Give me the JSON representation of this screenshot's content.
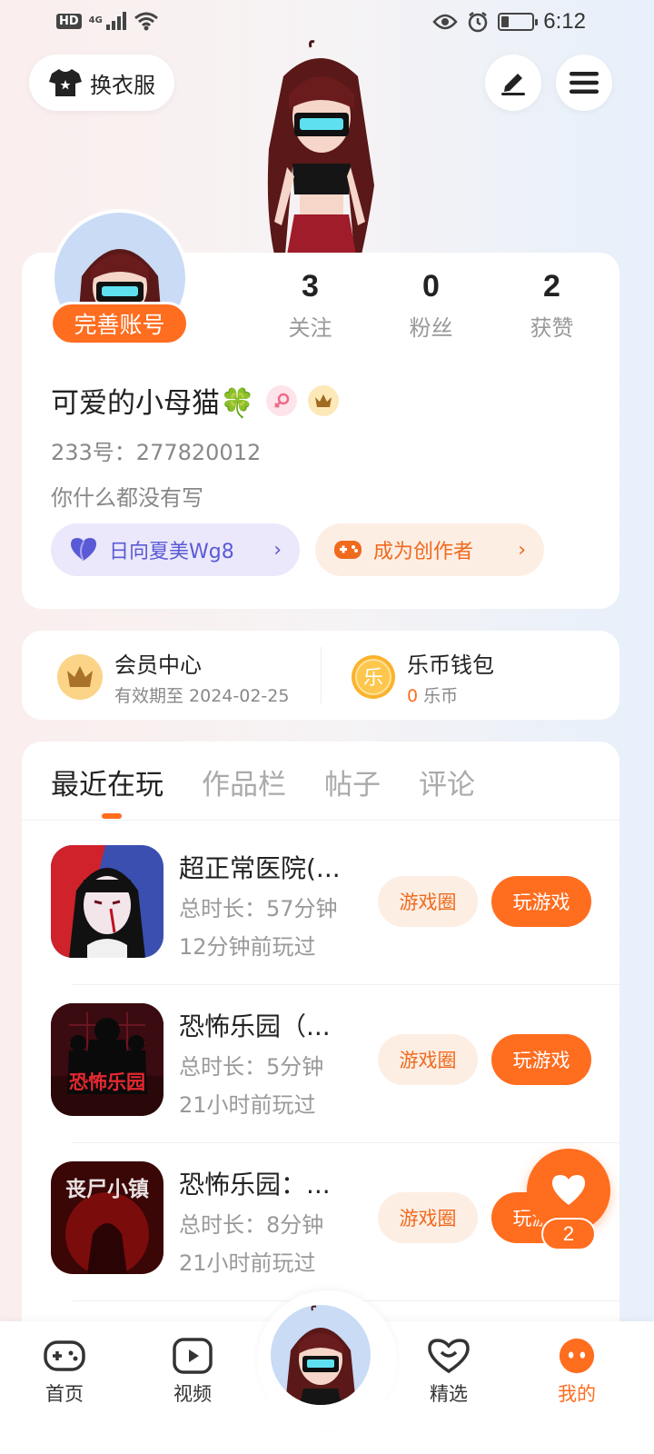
{
  "status_bar": {
    "network_badge": "HD",
    "signal_type": "4G",
    "battery_percent": 25,
    "time": "6:12"
  },
  "top_bar": {
    "outfit_label": "换衣服"
  },
  "profile": {
    "complete_account_label": "完善账号",
    "stats": [
      {
        "value": "3",
        "label": "关注"
      },
      {
        "value": "0",
        "label": "粉丝"
      },
      {
        "value": "2",
        "label": "获赞"
      }
    ],
    "nickname": "可爱的小母猫🍀",
    "uid": "233号：277820012",
    "bio": "你什么都没有写",
    "pill_left": "日向夏美Wg8",
    "pill_right": "成为创作者"
  },
  "vip": {
    "member_title": "会员中心",
    "member_sub": "有效期至 2024-02-25",
    "wallet_icon_char": "乐",
    "wallet_title": "乐币钱包",
    "wallet_amount": "0",
    "wallet_unit": "乐币"
  },
  "tabs": [
    "最近在玩",
    "作品栏",
    "帖子",
    "评论"
  ],
  "games": [
    {
      "title": "超正常医院(...",
      "duration": "总时长：57分钟",
      "last_played": "12分钟前玩过",
      "btn_circle": "游戏圈",
      "btn_play": "玩游戏"
    },
    {
      "title": "恐怖乐园（...",
      "duration": "总时长：5分钟",
      "last_played": "21小时前玩过",
      "btn_circle": "游戏圈",
      "btn_play": "玩游戏",
      "thumb_text": "恐怖乐园"
    },
    {
      "title": "恐怖乐园：...",
      "duration": "总时长：8分钟",
      "last_played": "21小时前玩过",
      "btn_circle": "游戏圈",
      "btn_play": "玩游戏",
      "thumb_text": "丧尸小镇"
    }
  ],
  "floating": {
    "like_count": "2"
  },
  "bottom_nav": [
    {
      "label": "首页"
    },
    {
      "label": "视频"
    },
    {
      "label": "精选"
    },
    {
      "label": "我的"
    }
  ],
  "colors": {
    "accent": "#ff6d1f",
    "purple": "#5a5ad6",
    "bg_left": "#fbeeee",
    "bg_right": "#e7f0fb"
  }
}
